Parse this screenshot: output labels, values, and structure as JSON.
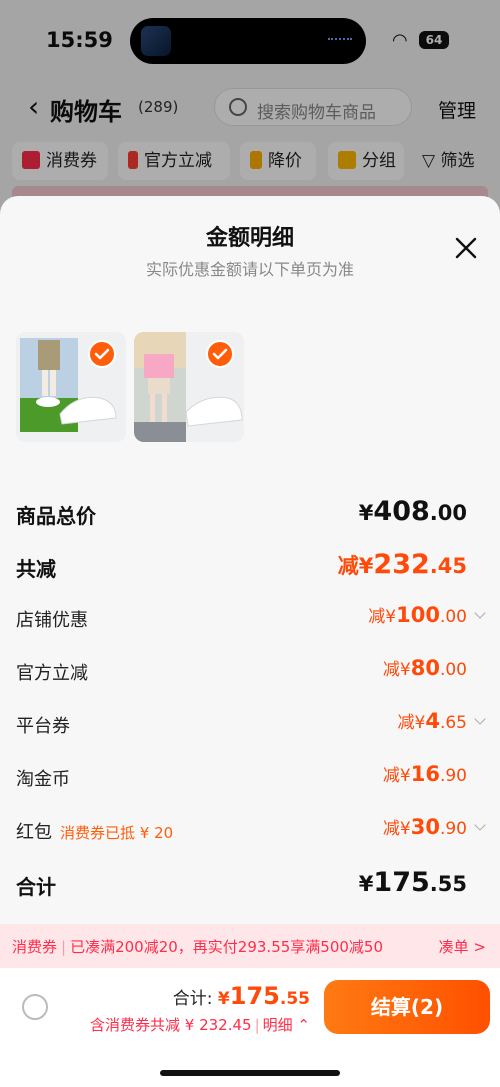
{
  "status_bar": {
    "time": "15:59",
    "battery": "64"
  },
  "nav": {
    "title": "购物车",
    "count": "(289)",
    "search_placeholder": "搜索购物车商品",
    "manage_label": "管理"
  },
  "filters": [
    {
      "label": "消费券",
      "icon": "voucher-icon",
      "color": "#ff2d4a"
    },
    {
      "label": "官方立减",
      "icon": "lightning-icon",
      "color": "#ff3b30"
    },
    {
      "label": "降价",
      "icon": "down-arrow-icon",
      "color": "#ffae00"
    },
    {
      "label": "分组",
      "icon": "folder-icon",
      "color": "#ffb800"
    }
  ],
  "filter_right": "筛选",
  "sheet": {
    "title": "金额明细",
    "subtitle": "实际优惠金额请以下单页为准"
  },
  "rows": {
    "goods_total": {
      "label": "商品总价",
      "currency": "¥",
      "int": "408",
      "dec": ".00"
    },
    "total_discount": {
      "label": "共减",
      "prefix": "减¥",
      "int": "232",
      "dec": ".45"
    },
    "shop_discount": {
      "label": "店铺优惠",
      "prefix": "减¥",
      "int": "100",
      "dec": ".00"
    },
    "official_discount": {
      "label": "官方立减",
      "prefix": "减¥",
      "int": "80",
      "dec": ".00"
    },
    "platform_coupon": {
      "label": "平台券",
      "prefix": "减¥",
      "int": "4",
      "dec": ".65"
    },
    "taojinbi": {
      "label": "淘金币",
      "prefix": "减¥",
      "int": "16",
      "dec": ".90"
    },
    "red_packet": {
      "label": "红包",
      "note": "消费券已抵 ¥ 20",
      "prefix": "减¥",
      "int": "30",
      "dec": ".90"
    },
    "sum": {
      "label": "合计",
      "currency": "¥",
      "int": "175",
      "dec": ".55"
    }
  },
  "promo": {
    "tag": "消费券",
    "text": "已凑满200减20，再实付293.55享满500减50",
    "link": "凑单 >"
  },
  "bottom": {
    "total_label": "合计:",
    "total_currency": "¥",
    "total_int": "175",
    "total_dec": ".55",
    "discount_text": "含消费券共减 ¥ 232.45",
    "detail_label": "明细",
    "checkout_label": "结算(2)"
  },
  "colors": {
    "accent": "#ff5000",
    "discount": "#ff4a0a",
    "promo_bg": "#ffe7e9"
  }
}
